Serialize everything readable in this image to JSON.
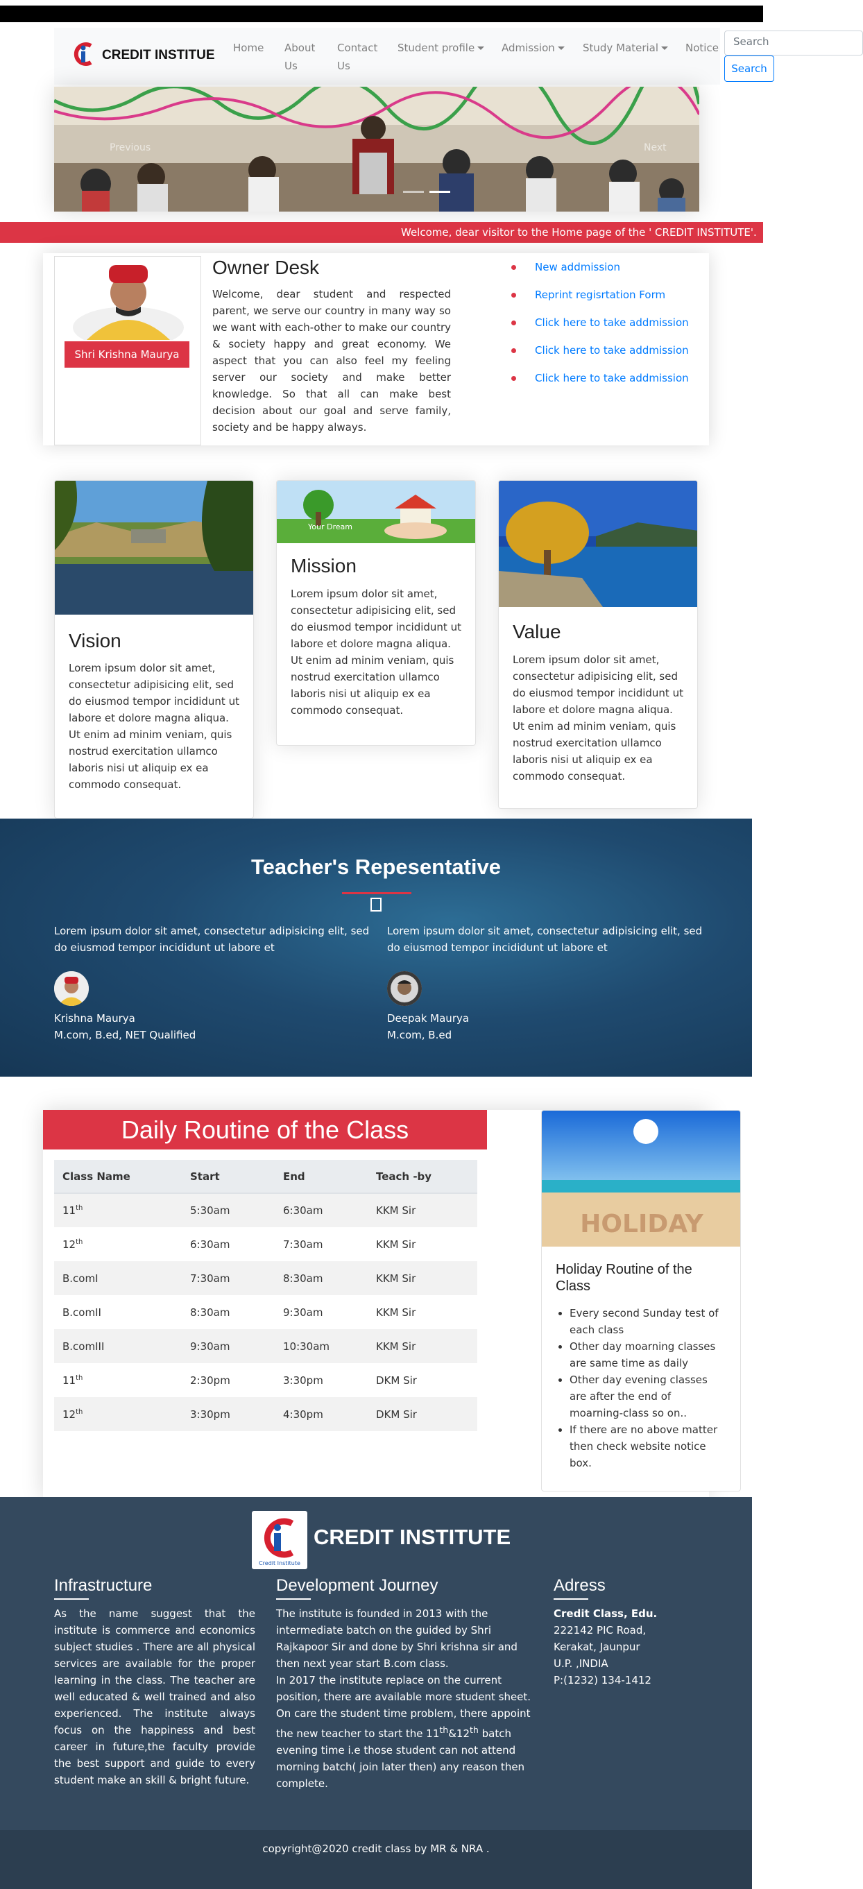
{
  "nav": {
    "brand": "CREDIT INSTITUE",
    "logo_text": "Credit Institute",
    "links": {
      "home": "Home",
      "about_1": "About",
      "about_2": "Us",
      "contact_1": "Contact",
      "contact_2": "Us",
      "student_profile": "Student profile",
      "admission": "Admission",
      "study_material": "Study Material",
      "notice": "Notice"
    },
    "search_placeholder": "Search",
    "search_button": "Search"
  },
  "carousel": {
    "prev": "Previous",
    "next": "Next"
  },
  "marquee": "Welcome, dear visitor to the Home page of the ' CREDIT INSTITUTE'.",
  "owner": {
    "name": "Shri Krishna Maurya",
    "title": "Owner Desk",
    "text": "Welcome, dear student and respected parent, we serve our country in many way so we want with each-other to make our country & society happy and great economy. We aspect that you can also feel my feeling server our society and make better knowledge. So that all can make best decision about our goal and serve family, society and be happy always.",
    "links": [
      "New addmission",
      "Reprint regisrtation Form",
      "Click here to take addmission",
      "Click here to take addmission",
      "Click here to take addmission"
    ]
  },
  "cards": {
    "vision": {
      "title": "Vision",
      "text": "Lorem ipsum dolor sit amet, consectetur adipisicing elit, sed do eiusmod tempor incididunt ut labore et dolore magna aliqua. Ut enim ad minim veniam, quis nostrud exercitation ullamco laboris nisi ut aliquip ex ea commodo consequat."
    },
    "mission": {
      "title": "Mission",
      "text": "Lorem ipsum dolor sit amet, consectetur adipisicing elit, sed do eiusmod tempor incididunt ut labore et dolore magna aliqua. Ut enim ad minim veniam, quis nostrud exercitation ullamco laboris nisi ut aliquip ex ea commodo consequat.",
      "image_caption": "Your Dream"
    },
    "value": {
      "title": "Value",
      "text": "Lorem ipsum dolor sit amet, consectetur adipisicing elit, sed do eiusmod tempor incididunt ut labore et dolore magna aliqua. Ut enim ad minim veniam, quis nostrud exercitation ullamco laboris nisi ut aliquip ex ea commodo consequat."
    }
  },
  "teachers": {
    "title": "Teacher's Repesentative",
    "items": [
      {
        "quote": "Lorem ipsum dolor sit amet, consectetur adipisicing elit, sed do eiusmod tempor incididunt ut labore et",
        "name": "Krishna Maurya",
        "qual": "M.com, B.ed, NET Qualified"
      },
      {
        "quote": "Lorem ipsum dolor sit amet, consectetur adipisicing elit, sed do eiusmod tempor incididunt ut labore et",
        "name": "Deepak Maurya",
        "qual": "M.com, B.ed"
      }
    ]
  },
  "routine": {
    "title": "Daily Routine of the Class",
    "headers": [
      "Class Name",
      "Start",
      "End",
      "Teach -by"
    ],
    "rows": [
      {
        "cls": "11",
        "sup": "th",
        "start": "5:30am",
        "end": "6:30am",
        "by": "KKM Sir"
      },
      {
        "cls": "12",
        "sup": "th",
        "start": "6:30am",
        "end": "7:30am",
        "by": "KKM Sir"
      },
      {
        "cls": "B.comI",
        "sup": "",
        "start": "7:30am",
        "end": "8:30am",
        "by": "KKM Sir"
      },
      {
        "cls": "B.comII",
        "sup": "",
        "start": "8:30am",
        "end": "9:30am",
        "by": "KKM Sir"
      },
      {
        "cls": "B.comIII",
        "sup": "",
        "start": "9:30am",
        "end": "10:30am",
        "by": "KKM Sir"
      },
      {
        "cls": "11",
        "sup": "th",
        "start": "2:30pm",
        "end": "3:30pm",
        "by": "DKM Sir"
      },
      {
        "cls": "12",
        "sup": "th",
        "start": "3:30pm",
        "end": "4:30pm",
        "by": "DKM Sir"
      }
    ]
  },
  "holiday": {
    "image_text": "HOLIDAY",
    "title": "Holiday Routine of the Class",
    "items": [
      "Every second Sunday test of each class",
      "Other day moarning classes are same time as daily",
      "Other day evening classes are after the end of moarning-class so on..",
      "If there are no above matter then check website notice box."
    ]
  },
  "footer": {
    "brand": "CREDIT INSTITUTE",
    "infra_title": "Infrastructure",
    "infra_text": "As the name suggest that the institute is commerce and economics subject studies . There are all physical services are available for the proper learning in the class. The teacher are well educated & well trained and also experienced. The institute always focus on the happiness and best career in future,the faculty provide the best support and guide to every student make an skill & bright future.",
    "journey_title": "Development Journey",
    "journey_p1": "The institute is founded in 2013 with the intermediate batch on the guided by Shri Rajkapoor Sir and done by Shri krishna sir and then next year start B.com class.",
    "journey_p2": "In 2017 the institute replace on the current position, there are available more student sheet.",
    "journey_p3_a": "On care the student time problem, there appoint the new teacher to start the 11",
    "journey_p3_sup1": "th",
    "journey_p3_b": "&12",
    "journey_p3_sup2": "th",
    "journey_p3_c": " batch evening time i.e those student can not attend morning batch( join later then) any reason then complete.",
    "addr_title": "Adress",
    "addr_name": "Credit Class, Edu.",
    "addr_lines": [
      "222142 PIC Road,",
      "Kerakat, Jaunpur",
      "U.P. ,INDIA",
      "P:(1232) 134-1412"
    ]
  },
  "copyright": "copyright@2020 credit class by MR & NRA ."
}
